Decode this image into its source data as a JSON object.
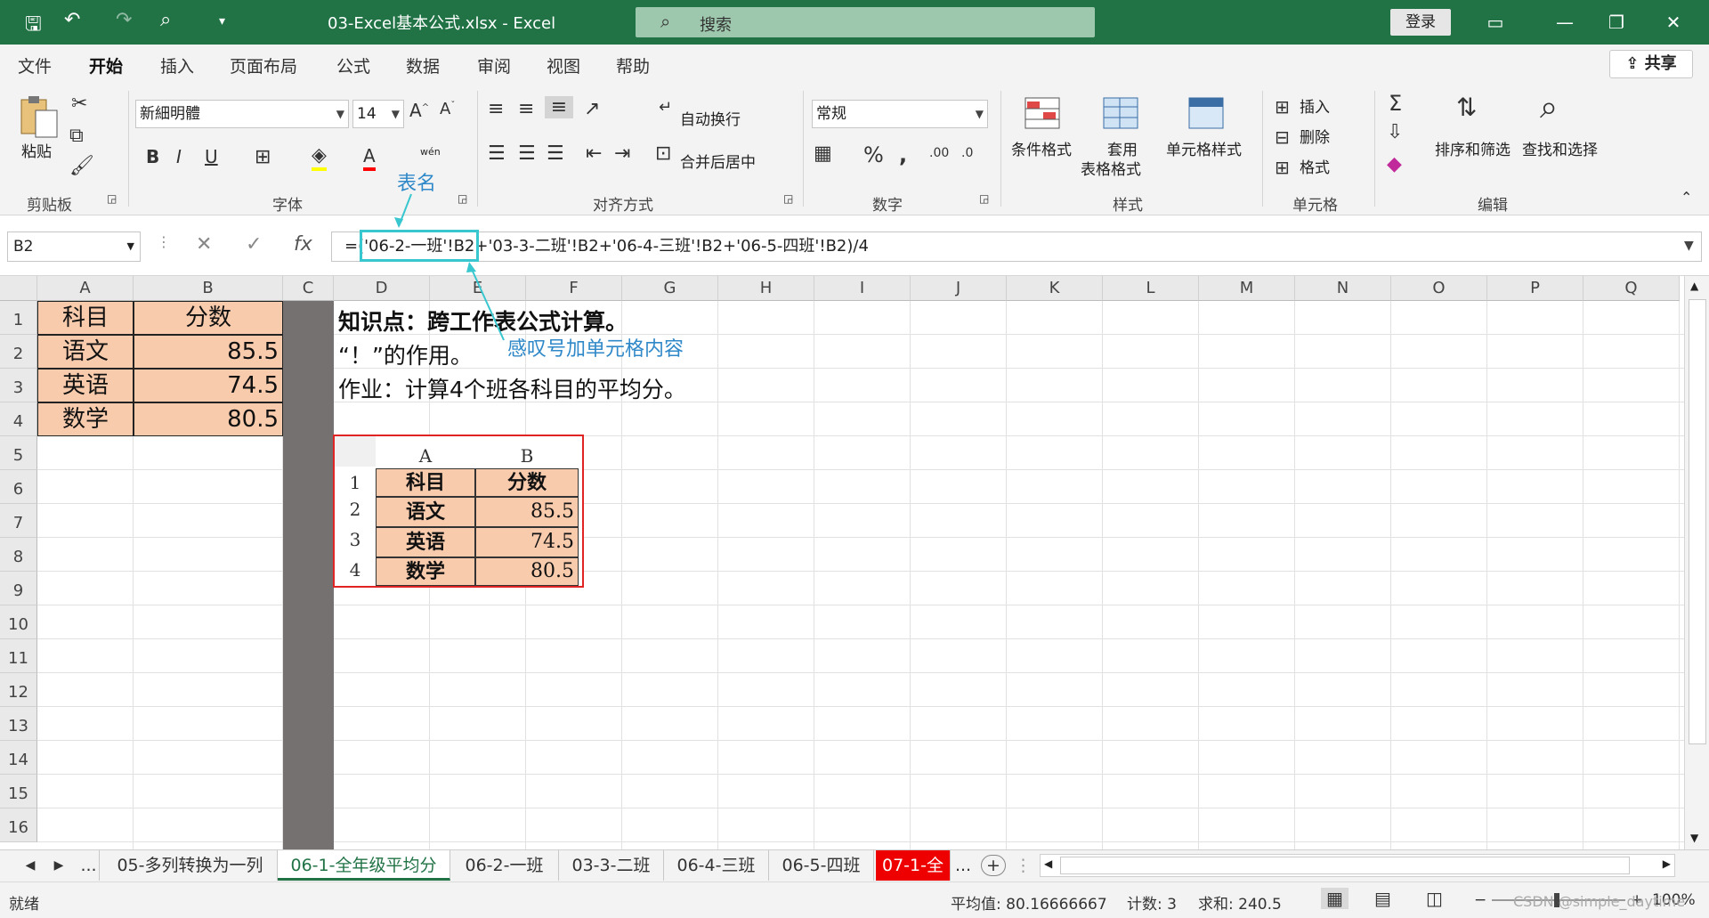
{
  "titlebar": {
    "doc_title": "03-Excel基本公式.xlsx  -  Excel",
    "search_placeholder": "搜索",
    "login_label": "登录"
  },
  "tabs": [
    "文件",
    "开始",
    "插入",
    "页面布局",
    "公式",
    "数据",
    "审阅",
    "视图",
    "帮助"
  ],
  "share_label": "共享",
  "ribbon": {
    "paste_label": "粘贴",
    "clipboard_label": "剪贴板",
    "font_name": "新細明體",
    "font_size": "14",
    "font_group_label": "字体",
    "wrap_text_label": "自动换行",
    "merge_center_label": "合并后居中",
    "align_group_label": "对齐方式",
    "number_format": "常规",
    "number_group_label": "数字",
    "cond_format_label": "条件格式",
    "table_format_label_1": "套用",
    "table_format_label_2": "表格格式",
    "cell_style_label": "单元格样式",
    "styles_group_label": "样式",
    "insert_label": "插入",
    "delete_label": "删除",
    "format_label": "格式",
    "cells_group_label": "单元格",
    "sort_filter_label": "排序和筛选",
    "find_select_label": "查找和选择",
    "editing_group_label": "编辑",
    "phonetic_label": "wén"
  },
  "formula_bar": {
    "name_box": "B2",
    "formula": "=('06-2-一班'!B2+'03-3-二班'!B2+'06-4-三班'!B2+'06-5-四班'!B2)/4"
  },
  "columns": [
    "A",
    "B",
    "C",
    "D",
    "E",
    "F",
    "G",
    "H",
    "I",
    "J",
    "K",
    "L",
    "M",
    "N",
    "O",
    "P",
    "Q"
  ],
  "rows": [
    "1",
    "2",
    "3",
    "4",
    "5",
    "6",
    "7",
    "8",
    "9",
    "10",
    "11",
    "12",
    "13",
    "14",
    "15",
    "16"
  ],
  "table": {
    "header": [
      "科目",
      "分数"
    ],
    "rows": [
      [
        "语文",
        "85.5"
      ],
      [
        "英语",
        "74.5"
      ],
      [
        "数学",
        "80.5"
      ]
    ]
  },
  "notes": {
    "d1": "知识点：跨工作表公式计算。",
    "d2": "“！”的作用。",
    "d3": "作业：计算4个班各科目的平均分。"
  },
  "annotations": {
    "sheet_name": "表名",
    "exclamation": "感叹号加单元格内容"
  },
  "picture": {
    "col_a": "A",
    "col_b": "B",
    "rows": [
      "1",
      "2",
      "3",
      "4"
    ],
    "header": [
      "科目",
      "分数"
    ],
    "data": [
      [
        "语文",
        "85.5"
      ],
      [
        "英语",
        "74.5"
      ],
      [
        "数学",
        "80.5"
      ]
    ]
  },
  "sheet_tabs": {
    "more": "...",
    "items": [
      "05-多列转换为一列",
      "06-1-全年级平均分",
      "06-2-一班",
      "03-3-二班",
      "06-4-三班",
      "06-5-四班",
      "07-1-全"
    ],
    "more_right": "...",
    "add_label": "+"
  },
  "status": {
    "ready": "就绪",
    "average": "平均值: 80.16666667",
    "count": "计数: 3",
    "sum": "求和: 240.5",
    "zoom": "100%",
    "watermark": "CSDN @simple_daytime"
  },
  "colors": {
    "excel_green": "#217346",
    "cell_fill": "#f8cbad",
    "annotation": "#2f88c8",
    "highlight": "#38c6cf",
    "red_tab": "#ee0000"
  }
}
